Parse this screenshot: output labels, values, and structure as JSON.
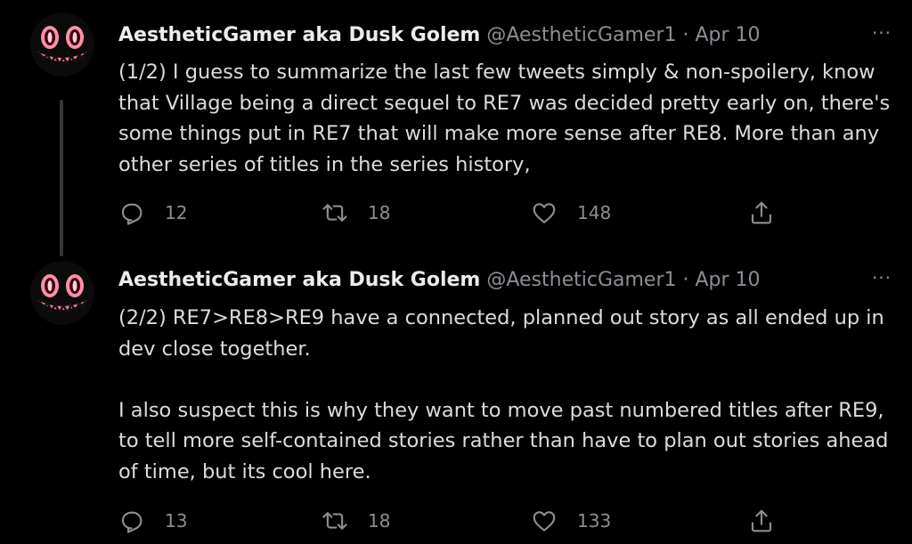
{
  "tweets": [
    {
      "author_name": "AestheticGamer aka Dusk Golem",
      "handle": "@AestheticGamer1",
      "separator": "·",
      "date": "Apr 10",
      "more_label": "···",
      "paragraphs": [
        "(1/2) I guess to summarize the last few tweets simply & non-spoilery, know that Village being a direct sequel to RE7 was decided pretty early on, there's some things put in RE7 that will make more sense after RE8. More than any other series of titles in the series history,"
      ],
      "reply_count": "12",
      "retweet_count": "18",
      "like_count": "148"
    },
    {
      "author_name": "AestheticGamer aka Dusk Golem",
      "handle": "@AestheticGamer1",
      "separator": "·",
      "date": "Apr 10",
      "more_label": "···",
      "paragraphs": [
        "(2/2) RE7>RE8>RE9 have a connected, planned out story as all ended up in dev close together.",
        "I also suspect this is why they want to move past numbered titles after RE9, to tell more self-contained stories rather than have to plan out stories ahead of time, but its cool here."
      ],
      "reply_count": "13",
      "retweet_count": "18",
      "like_count": "133"
    }
  ],
  "icons": {
    "avatar": "grinning-monster-face",
    "reply": "reply-icon",
    "retweet": "retweet-icon",
    "like": "heart-icon",
    "share": "share-icon",
    "more": "more-icon"
  },
  "colors": {
    "background": "#000000",
    "text": "#dcdcdc",
    "muted": "#8b8f94",
    "thread_line": "#333639",
    "avatar_eyes": "#ff6b8a"
  }
}
